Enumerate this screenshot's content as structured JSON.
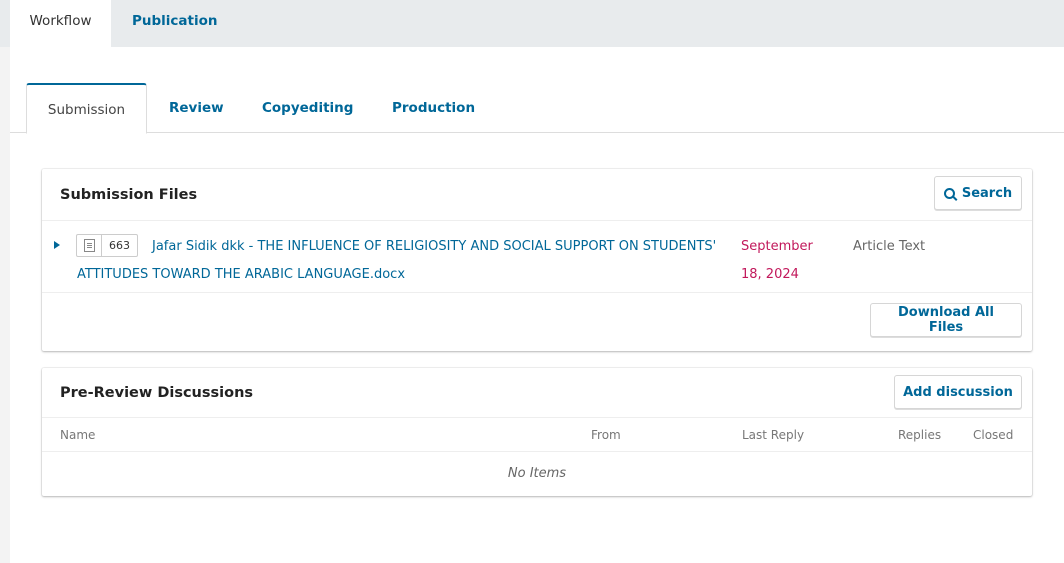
{
  "top_tabs": {
    "workflow": "Workflow",
    "publication": "Publication"
  },
  "sub_tabs": {
    "submission": "Submission",
    "review": "Review",
    "copyediting": "Copyediting",
    "production": "Production"
  },
  "submission_files": {
    "title": "Submission Files",
    "search_label": "Search",
    "file": {
      "id": "663",
      "name": "Jafar Sidik dkk - THE INFLUENCE OF RELIGIOSITY AND SOCIAL SUPPORT ON STUDENTS' ATTITUDES TOWARD THE ARABIC LANGUAGE.docx",
      "date": "September 18, 2024",
      "type": "Article Text"
    },
    "download_all_label": "Download All Files"
  },
  "discussions": {
    "title": "Pre-Review Discussions",
    "add_label": "Add discussion",
    "columns": [
      "Name",
      "From",
      "Last Reply",
      "Replies",
      "Closed"
    ],
    "empty_text": "No Items"
  },
  "colors": {
    "link": "#006798",
    "date": "#c2185b"
  }
}
